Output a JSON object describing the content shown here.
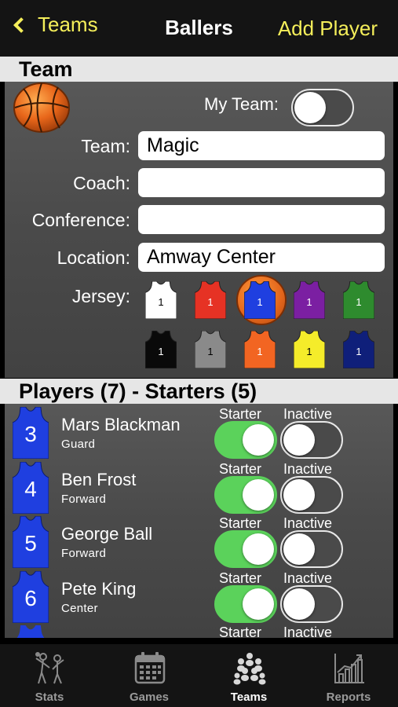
{
  "nav": {
    "back_label": "Teams",
    "title": "Ballers",
    "add_label": "Add Player"
  },
  "team_section": {
    "header": "Team",
    "my_team_label": "My Team:",
    "my_team_on": false,
    "fields": {
      "team": {
        "label": "Team:",
        "value": "Magic"
      },
      "coach": {
        "label": "Coach:",
        "value": ""
      },
      "conference": {
        "label": "Conference:",
        "value": ""
      },
      "location": {
        "label": "Location:",
        "value": "Amway Center"
      }
    },
    "jersey_label": "Jersey:",
    "jersey_number": "1",
    "jerseys": [
      {
        "color": "#ffffff",
        "number_color": "#000000",
        "selected": false
      },
      {
        "color": "#e63224",
        "number_color": "#ffffff",
        "selected": false
      },
      {
        "color": "#1f3fe0",
        "number_color": "#ffffff",
        "selected": true
      },
      {
        "color": "#7b1fa2",
        "number_color": "#ffffff",
        "selected": false
      },
      {
        "color": "#2e8b2e",
        "number_color": "#ffffff",
        "selected": false
      },
      {
        "color": "#0a0a0a",
        "number_color": "#ffffff",
        "selected": false
      },
      {
        "color": "#8a8a8a",
        "number_color": "#000000",
        "selected": false
      },
      {
        "color": "#f26522",
        "number_color": "#ffffff",
        "selected": false
      },
      {
        "color": "#f5ec2a",
        "number_color": "#000000",
        "selected": false
      },
      {
        "color": "#0f1f7a",
        "number_color": "#ffffff",
        "selected": false
      }
    ]
  },
  "players_section": {
    "header": "Players (7) - Starters (5)",
    "starter_label": "Starter",
    "inactive_label": "Inactive",
    "jersey_color": "#1f3fe0",
    "players": [
      {
        "number": "3",
        "name": "Mars Blackman",
        "position": "Guard",
        "starter": true,
        "inactive": false
      },
      {
        "number": "4",
        "name": "Ben Frost",
        "position": "Forward",
        "starter": true,
        "inactive": false
      },
      {
        "number": "5",
        "name": "George Ball",
        "position": "Forward",
        "starter": true,
        "inactive": false
      },
      {
        "number": "6",
        "name": "Pete King",
        "position": "Center",
        "starter": true,
        "inactive": false
      }
    ]
  },
  "tabbar": {
    "tabs": [
      {
        "label": "Stats",
        "icon": "players-icon",
        "active": false
      },
      {
        "label": "Games",
        "icon": "calendar-icon",
        "active": false
      },
      {
        "label": "Teams",
        "icon": "group-icon",
        "active": true
      },
      {
        "label": "Reports",
        "icon": "bar-chart-icon",
        "active": false
      }
    ]
  },
  "colors": {
    "accent": "#f4ee5a",
    "toggle_on": "#5bd25b",
    "header_bg": "#e6e6e6"
  }
}
